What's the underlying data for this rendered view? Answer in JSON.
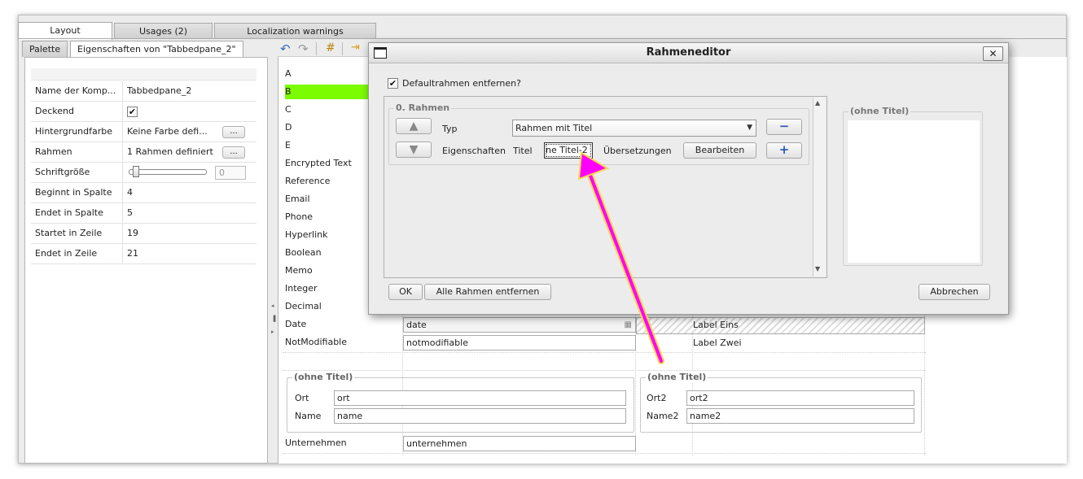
{
  "tabs": {
    "layout": "Layout",
    "usages": "Usages (2)",
    "localization": "Localization warnings"
  },
  "subtabs": {
    "palette": "Palette",
    "properties": "Eigenschaften von \"Tabbedpane_2\""
  },
  "properties": [
    {
      "label": "Name der Komp...",
      "value": "Tabbedpane_2"
    },
    {
      "label": "Deckend",
      "value": "✔"
    },
    {
      "label": "Hintergrundfarbe",
      "value": "Keine Farbe defi...",
      "button": "..."
    },
    {
      "label": "Rahmen",
      "value": "1 Rahmen definiert",
      "button": "..."
    },
    {
      "label": "Schriftgröße",
      "value": "0"
    },
    {
      "label": "Beginnt in Spalte",
      "value": "4"
    },
    {
      "label": "Endet in Spalte",
      "value": "5"
    },
    {
      "label": "Startet in Zeile",
      "value": "19"
    },
    {
      "label": "Endet in Zeile",
      "value": "21"
    }
  ],
  "form": {
    "labels": [
      "A",
      "B",
      "C",
      "D",
      "E",
      "Encrypted Text",
      "Reference",
      "Email",
      "Phone",
      "Hyperlink",
      "Boolean",
      "Memo",
      "Integer",
      "Decimal",
      "Date",
      "NotModifiable"
    ],
    "date_value": "date",
    "notmodifiable_value": "notmodifiable",
    "label_eins": "Label Eins",
    "label_zwei": "Label Zwei",
    "group1": {
      "title": "(ohne Titel)",
      "ort_label": "Ort",
      "ort_value": "ort",
      "name_label": "Name",
      "name_value": "name"
    },
    "group2": {
      "title": "(ohne Titel)",
      "ort_label": "Ort2",
      "ort_value": "ort2",
      "name_label": "Name2",
      "name_value": "name2"
    },
    "unternehmen_label": "Unternehmen",
    "unternehmen_value": "unternehmen"
  },
  "dialog": {
    "title": "Rahmeneditor",
    "close": "✕",
    "checkbox_label": "Defaultrahmen entfernen?",
    "checkbox_mark": "✔",
    "frame_title": "0. Rahmen",
    "typ_label": "Typ",
    "typ_value": "Rahmen mit Titel",
    "eigenschaften_label": "Eigenschaften",
    "titel_label": "Titel",
    "titel_value": "ne Titel-2",
    "uebersetzungen_label": "Übersetzungen",
    "bearbeiten": "Bearbeiten",
    "preview_title": "(ohne Titel)",
    "ok": "OK",
    "remove_all": "Alle Rahmen entfernen",
    "cancel": "Abbrechen"
  },
  "colors": {
    "highlight": "#7cfc00",
    "arrow": "#ff00ff",
    "dialog_bg": "#ececec"
  }
}
